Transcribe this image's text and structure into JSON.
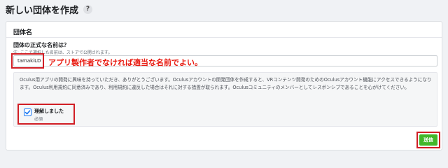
{
  "header": {
    "title": "新しい団体を作成",
    "help_icon": "question-circle-icon"
  },
  "form": {
    "section_title": "団体名",
    "name_label": "団体の正式な名前は？",
    "name_hint": "注: ここで選択した名前は、ストアで公開されます。",
    "name_value": "tamakiLD",
    "annotation": "アプリ製作者でなければ適当な名前でよい。",
    "agreement_text": "Oculus用アプリの開発に興味を持っていただき、ありがとうございます。Oculusアカウントの開発団体を作成すると、VRコンテンツ開発のためのOculusアカウント機能にアクセスできるようになります。Oculus利用規約に同意済みであり、利用規約に違反した場合はそれに対する措置が取られます。Oculusコミュニティのメンバーとしてレスポンシブであることを心がけてください。",
    "checkbox_label": "理解しました",
    "checkbox_required": "必須",
    "checkbox_checked": true,
    "submit_label": "送信"
  },
  "colors": {
    "highlight_red": "#d11e25",
    "annotation_red": "#e8190f",
    "submit_green": "#42b72a",
    "checkbox_blue": "#1877f2"
  }
}
